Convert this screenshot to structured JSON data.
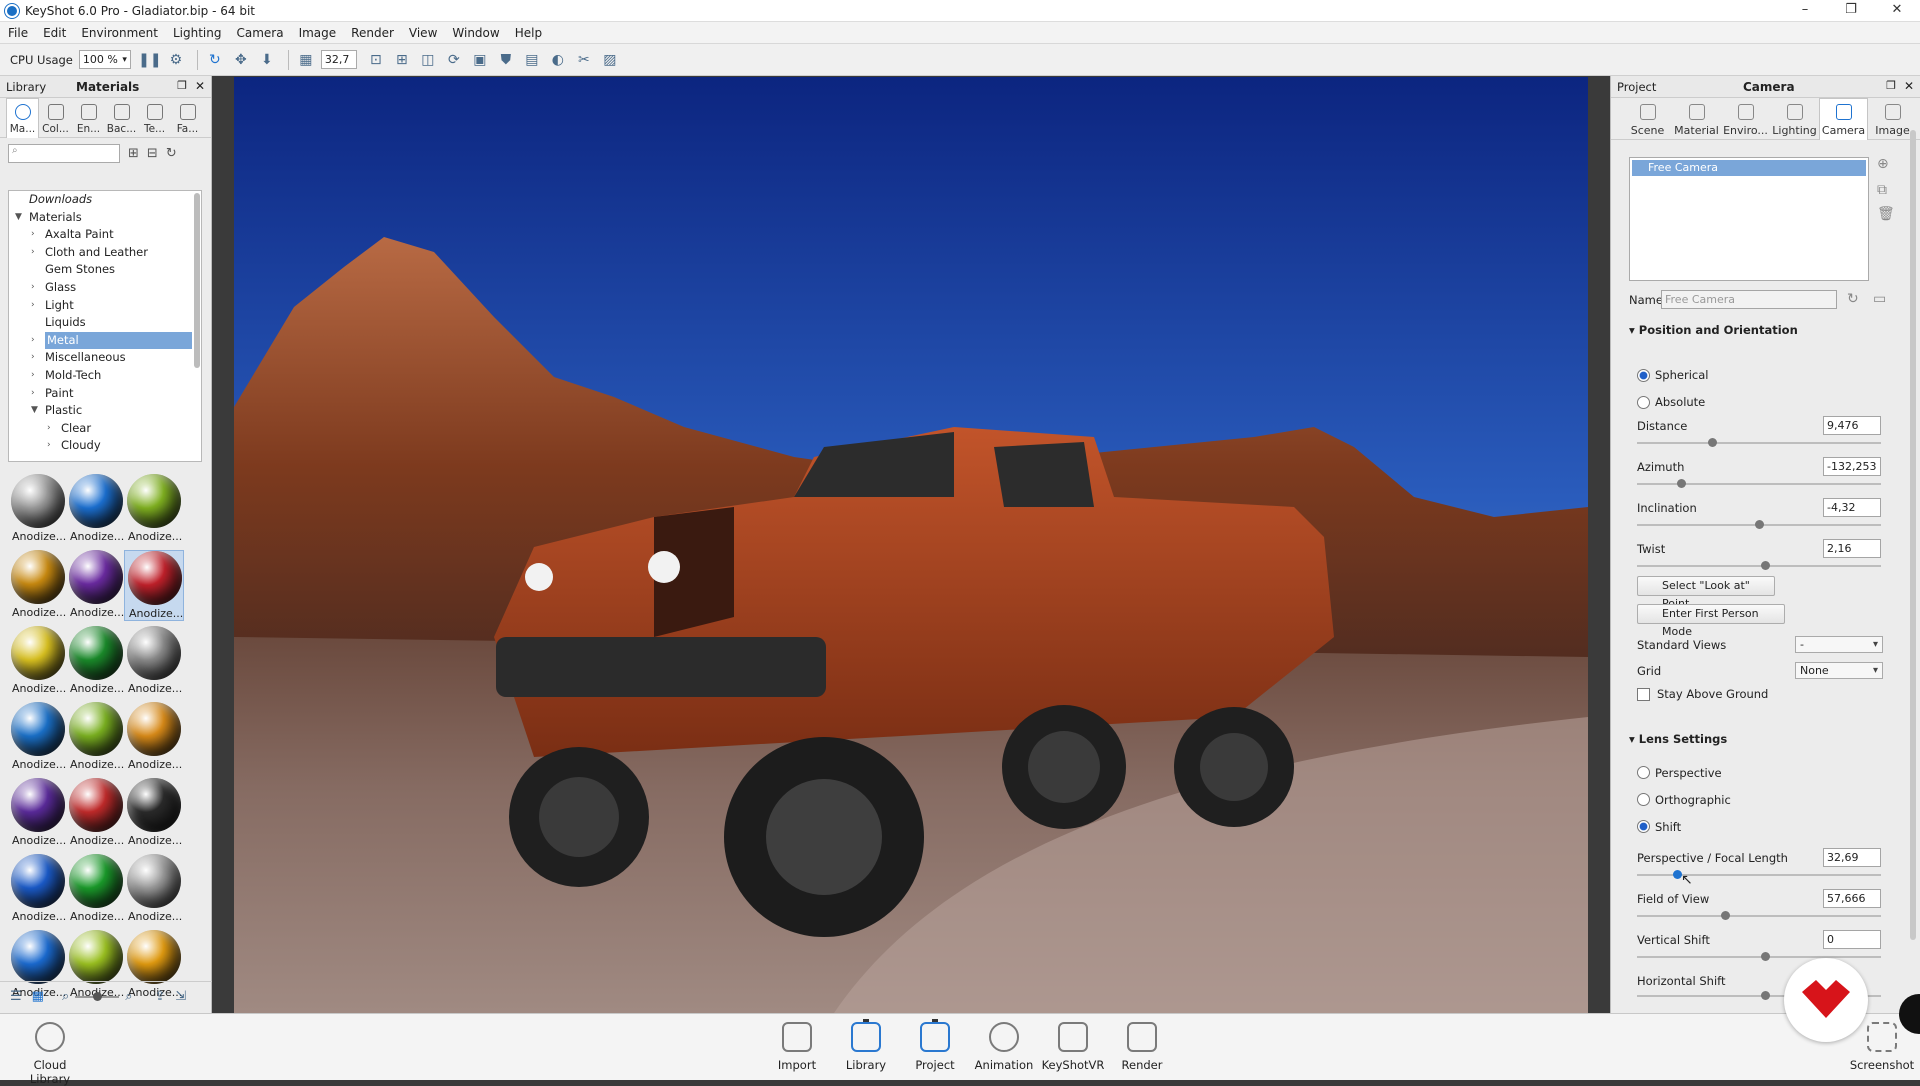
{
  "window": {
    "title": "KeyShot 6.0 Pro - Gladiator.bip - 64 bit",
    "controls": [
      "–",
      "❐",
      "✕"
    ]
  },
  "menu": [
    "File",
    "Edit",
    "Environment",
    "Lighting",
    "Camera",
    "Image",
    "Render",
    "View",
    "Window",
    "Help"
  ],
  "toolbar": {
    "cpu_label": "CPU Usage",
    "cpu_value": "100 %",
    "zoom_value": "32,7"
  },
  "library": {
    "panel_title": "Library",
    "section_title": "Materials",
    "tabs": [
      "Ma...",
      "Col...",
      "En...",
      "Bac...",
      "Te...",
      "Fa..."
    ],
    "tree": [
      {
        "label": "Downloads",
        "indent": 0,
        "italic": true
      },
      {
        "label": "Materials",
        "indent": 0,
        "open": true
      },
      {
        "label": "Axalta Paint",
        "indent": 1
      },
      {
        "label": "Cloth and Leather",
        "indent": 1
      },
      {
        "label": "Gem Stones",
        "indent": 1,
        "leaf": true
      },
      {
        "label": "Glass",
        "indent": 1
      },
      {
        "label": "Light",
        "indent": 1
      },
      {
        "label": "Liquids",
        "indent": 1,
        "leaf": true
      },
      {
        "label": "Metal",
        "indent": 1,
        "selected": true
      },
      {
        "label": "Miscellaneous",
        "indent": 1
      },
      {
        "label": "Mold-Tech",
        "indent": 1
      },
      {
        "label": "Paint",
        "indent": 1
      },
      {
        "label": "Plastic",
        "indent": 1,
        "open": true
      },
      {
        "label": "Clear",
        "indent": 2
      },
      {
        "label": "Cloudy",
        "indent": 2
      }
    ],
    "thumb_caption": "Anodize...",
    "thumb_colors": [
      "#9a9a9a",
      "#1b6fd0",
      "#7fb020",
      "#c98a10",
      "#6a2aa0",
      "#c0202a",
      "#d8c020",
      "#1a8a2a",
      "#8a8a8a",
      "#1a70c8",
      "#7ab020",
      "#d88a18",
      "#5a2a9a",
      "#c02a2a",
      "#2a2a2a",
      "#1a5ac8",
      "#1a9a2a",
      "#9a9a9a",
      "#1a6ad0",
      "#9ac020",
      "#e09a10"
    ]
  },
  "viewport": {
    "label": "render-viewport"
  },
  "project": {
    "panel_title": "Project",
    "section_title": "Camera",
    "tabs": [
      "Scene",
      "Material",
      "Enviro...",
      "Lighting",
      "Camera",
      "Image"
    ],
    "camera_item": "Free Camera",
    "name_label": "Name",
    "name_placeholder": "Free Camera",
    "pos_section": "Position and Orientation",
    "spherical": "Spherical",
    "absolute": "Absolute",
    "distance_label": "Distance",
    "distance": "9,476",
    "azimuth_label": "Azimuth",
    "azimuth": "-132,253",
    "inclination_label": "Inclination",
    "inclination": "-4,32",
    "twist_label": "Twist",
    "twist": "2,16",
    "lookat_btn": "Select \"Look at\" Point",
    "fp_btn": "Enter First Person Mode",
    "std_views_label": "Standard Views",
    "std_views_value": "-",
    "grid_label": "Grid",
    "grid_value": "None",
    "stay_above": "Stay Above Ground",
    "lens_section": "Lens Settings",
    "perspective": "Perspective",
    "orthographic": "Orthographic",
    "shift": "Shift",
    "focal_label": "Perspective / Focal Length",
    "focal": "32,69",
    "fov_label": "Field of View",
    "fov": "57,666",
    "vshift_label": "Vertical Shift",
    "vshift": "0",
    "hshift_label": "Horizontal Shift"
  },
  "bottom": {
    "cloud": "Cloud Library",
    "buttons": [
      "Import",
      "Library",
      "Project",
      "Animation",
      "KeyShotVR",
      "Render"
    ],
    "screenshot": "Screenshot"
  }
}
